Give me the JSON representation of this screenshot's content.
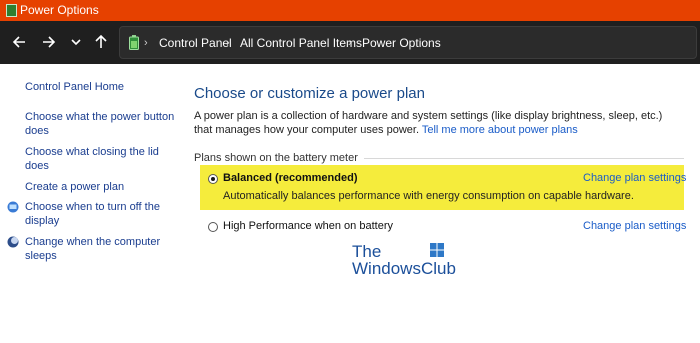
{
  "window": {
    "title": "Power Options"
  },
  "nav": {
    "back_icon": "arrow-left-icon",
    "forward_icon": "arrow-right-icon",
    "recent_icon": "chevron-down-icon",
    "up_icon": "arrow-up-icon"
  },
  "breadcrumb": [
    "Control Panel",
    "All Control Panel Items",
    "Power Options"
  ],
  "sidebar": {
    "home": "Control Panel Home",
    "links": [
      [
        "Choose what the power button",
        "does"
      ],
      [
        "Choose what closing the lid",
        "does"
      ],
      [
        "Create a power plan"
      ],
      [
        "Choose when to turn off the",
        "display"
      ],
      [
        "Change when the computer",
        "sleeps"
      ]
    ]
  },
  "main": {
    "heading": "Choose or customize a power plan",
    "description": "A power plan is a collection of hardware and system settings (like display brightness, sleep, etc.) that manages how your computer uses power.",
    "tell_me_link": "Tell me more about power plans",
    "group_label": "Plans shown on the battery meter",
    "plans": [
      {
        "name": "Balanced (recommended)",
        "description": "Automatically balances performance with energy consumption on capable hardware.",
        "selected": true,
        "change_link": "Change plan settings"
      },
      {
        "name": "High Performance when on battery",
        "selected": false,
        "change_link": "Change plan settings"
      }
    ]
  },
  "watermark": {
    "line1": "The",
    "line2": "WindowsClub"
  },
  "colors": {
    "titlebar": "#e64100",
    "navbar": "#1f1f1f",
    "link": "#1a5cc8",
    "heading": "#1a4a8a",
    "highlight": "#f5ec3c"
  }
}
